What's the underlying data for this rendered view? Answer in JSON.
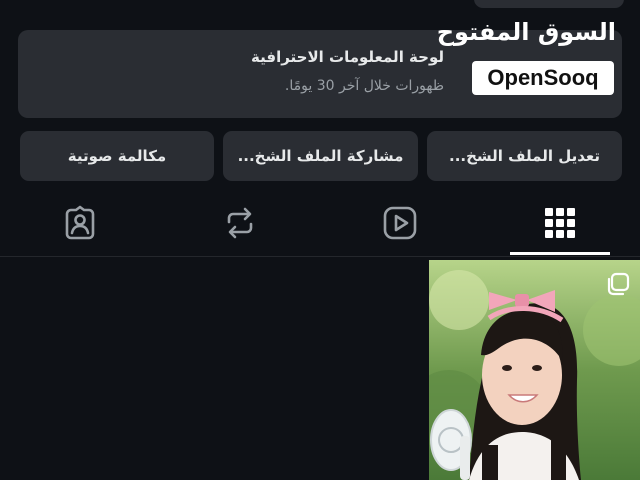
{
  "professional_panel": {
    "title": "لوحة المعلومات الاحترافية",
    "subtitle": "ظهورات خلال آخر 30 يومًا."
  },
  "watermark": {
    "arabic": "السوق المفتوح",
    "brand": "OpenSooq"
  },
  "actions": {
    "edit_profile": "تعديل الملف الشخ...",
    "share_profile": "مشاركة الملف الشخ...",
    "voice_call": "مكالمة صوتية"
  },
  "tabs": [
    {
      "icon": "grid-icon",
      "selected": true
    },
    {
      "icon": "reels-play-icon",
      "selected": false
    },
    {
      "icon": "repost-icon",
      "selected": false
    },
    {
      "icon": "tagged-person-icon",
      "selected": false
    }
  ],
  "colors": {
    "background": "#0e1116",
    "card": "#2a2d33",
    "text": "#e7e9ea",
    "muted": "#9aa0a6",
    "indicator": "#ffffff"
  },
  "posts": [
    {
      "type": "carousel",
      "icon": "multiple-posts-icon"
    }
  ]
}
